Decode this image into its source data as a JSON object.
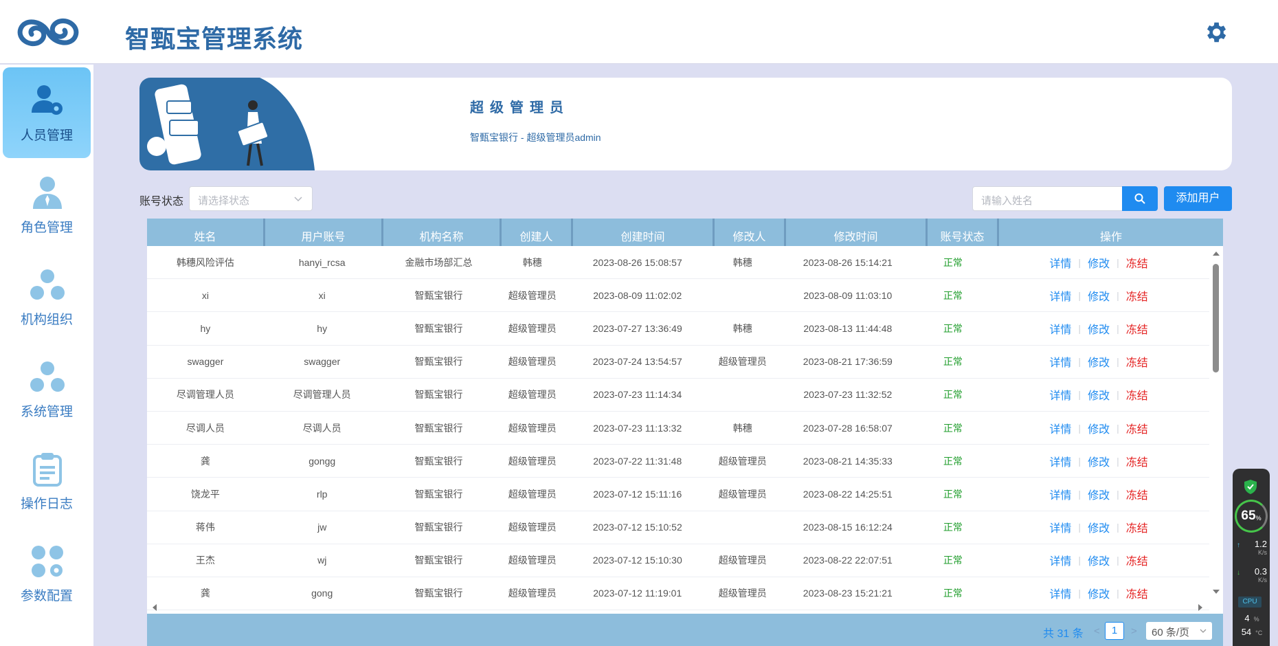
{
  "header": {
    "title": "智甄宝管理系统"
  },
  "sidebar": {
    "items": [
      {
        "label": "人员管理",
        "icon": "user-gear-icon",
        "active": true
      },
      {
        "label": "角色管理",
        "icon": "user-tie-icon",
        "active": false
      },
      {
        "label": "机构组织",
        "icon": "org-icon",
        "active": false
      },
      {
        "label": "系统管理",
        "icon": "system-icon",
        "active": false
      },
      {
        "label": "操作日志",
        "icon": "clipboard-icon",
        "active": false
      },
      {
        "label": "参数配置",
        "icon": "params-icon",
        "active": false
      }
    ]
  },
  "banner": {
    "title": "超级管理员",
    "subtitle": "智甄宝银行 - 超级管理员admin"
  },
  "filters": {
    "status_label": "账号状态",
    "status_placeholder": "请选择状态",
    "search_placeholder": "请输入姓名",
    "add_button": "添加用户"
  },
  "table": {
    "columns": [
      "姓名",
      "用户账号",
      "机构名称",
      "创建人",
      "创建时间",
      "修改人",
      "修改时间",
      "账号状态",
      "操作"
    ],
    "actions": {
      "detail": "详情",
      "edit": "修改",
      "freeze": "冻结"
    },
    "rows": [
      {
        "name": "韩穗风险评估",
        "account": "hanyi_rcsa",
        "org": "金融市场部汇总",
        "creator": "韩穗",
        "created": "2023-08-26 15:08:57",
        "modifier": "韩穗",
        "modified": "2023-08-26 15:14:21",
        "status": "正常"
      },
      {
        "name": "xi",
        "account": "xi",
        "org": "智甄宝银行",
        "creator": "超级管理员",
        "created": "2023-08-09 11:02:02",
        "modifier": "",
        "modified": "2023-08-09 11:03:10",
        "status": "正常"
      },
      {
        "name": "hy",
        "account": "hy",
        "org": "智甄宝银行",
        "creator": "超级管理员",
        "created": "2023-07-27 13:36:49",
        "modifier": "韩穗",
        "modified": "2023-08-13 11:44:48",
        "status": "正常"
      },
      {
        "name": "swagger",
        "account": "swagger",
        "org": "智甄宝银行",
        "creator": "超级管理员",
        "created": "2023-07-24 13:54:57",
        "modifier": "超级管理员",
        "modified": "2023-08-21 17:36:59",
        "status": "正常"
      },
      {
        "name": "尽调管理人员",
        "account": "尽调管理人员",
        "org": "智甄宝银行",
        "creator": "超级管理员",
        "created": "2023-07-23 11:14:34",
        "modifier": "",
        "modified": "2023-07-23 11:32:52",
        "status": "正常"
      },
      {
        "name": "尽调人员",
        "account": "尽调人员",
        "org": "智甄宝银行",
        "creator": "超级管理员",
        "created": "2023-07-23 11:13:32",
        "modifier": "韩穗",
        "modified": "2023-07-28 16:58:07",
        "status": "正常"
      },
      {
        "name": "龚",
        "account": "gongg",
        "org": "智甄宝银行",
        "creator": "超级管理员",
        "created": "2023-07-22 11:31:48",
        "modifier": "超级管理员",
        "modified": "2023-08-21 14:35:33",
        "status": "正常"
      },
      {
        "name": "饶龙平",
        "account": "rlp",
        "org": "智甄宝银行",
        "creator": "超级管理员",
        "created": "2023-07-12 15:11:16",
        "modifier": "超级管理员",
        "modified": "2023-08-22 14:25:51",
        "status": "正常"
      },
      {
        "name": "蒋伟",
        "account": "jw",
        "org": "智甄宝银行",
        "creator": "超级管理员",
        "created": "2023-07-12 15:10:52",
        "modifier": "",
        "modified": "2023-08-15 16:12:24",
        "status": "正常"
      },
      {
        "name": "王杰",
        "account": "wj",
        "org": "智甄宝银行",
        "creator": "超级管理员",
        "created": "2023-07-12 15:10:30",
        "modifier": "超级管理员",
        "modified": "2023-08-22 22:07:51",
        "status": "正常"
      },
      {
        "name": "龚",
        "account": "gong",
        "org": "智甄宝银行",
        "creator": "超级管理员",
        "created": "2023-07-12 11:19:01",
        "modifier": "超级管理员",
        "modified": "2023-08-23 15:21:21",
        "status": "正常"
      }
    ]
  },
  "pagination": {
    "total": "共 31 条",
    "prev": "<",
    "next": ">",
    "current_page": "1",
    "page_size": "60 条/页"
  },
  "overlay_widget": {
    "percent": "65",
    "percent_unit": "%",
    "upload": "1.2",
    "upload_unit": "K/s",
    "download": "0.3",
    "download_unit": "K/s",
    "cpu_label": "CPU",
    "cpu_usage": "4",
    "cpu_usage_unit": "%",
    "cpu_temp": "54",
    "cpu_temp_unit": "°C"
  },
  "colors": {
    "primary": "#1f8bf0",
    "header_text": "#2e6aa6",
    "table_header": "#8dbddc",
    "status_ok": "#1f9d2b",
    "danger": "#e42323",
    "page_bg": "#dcdef2"
  }
}
